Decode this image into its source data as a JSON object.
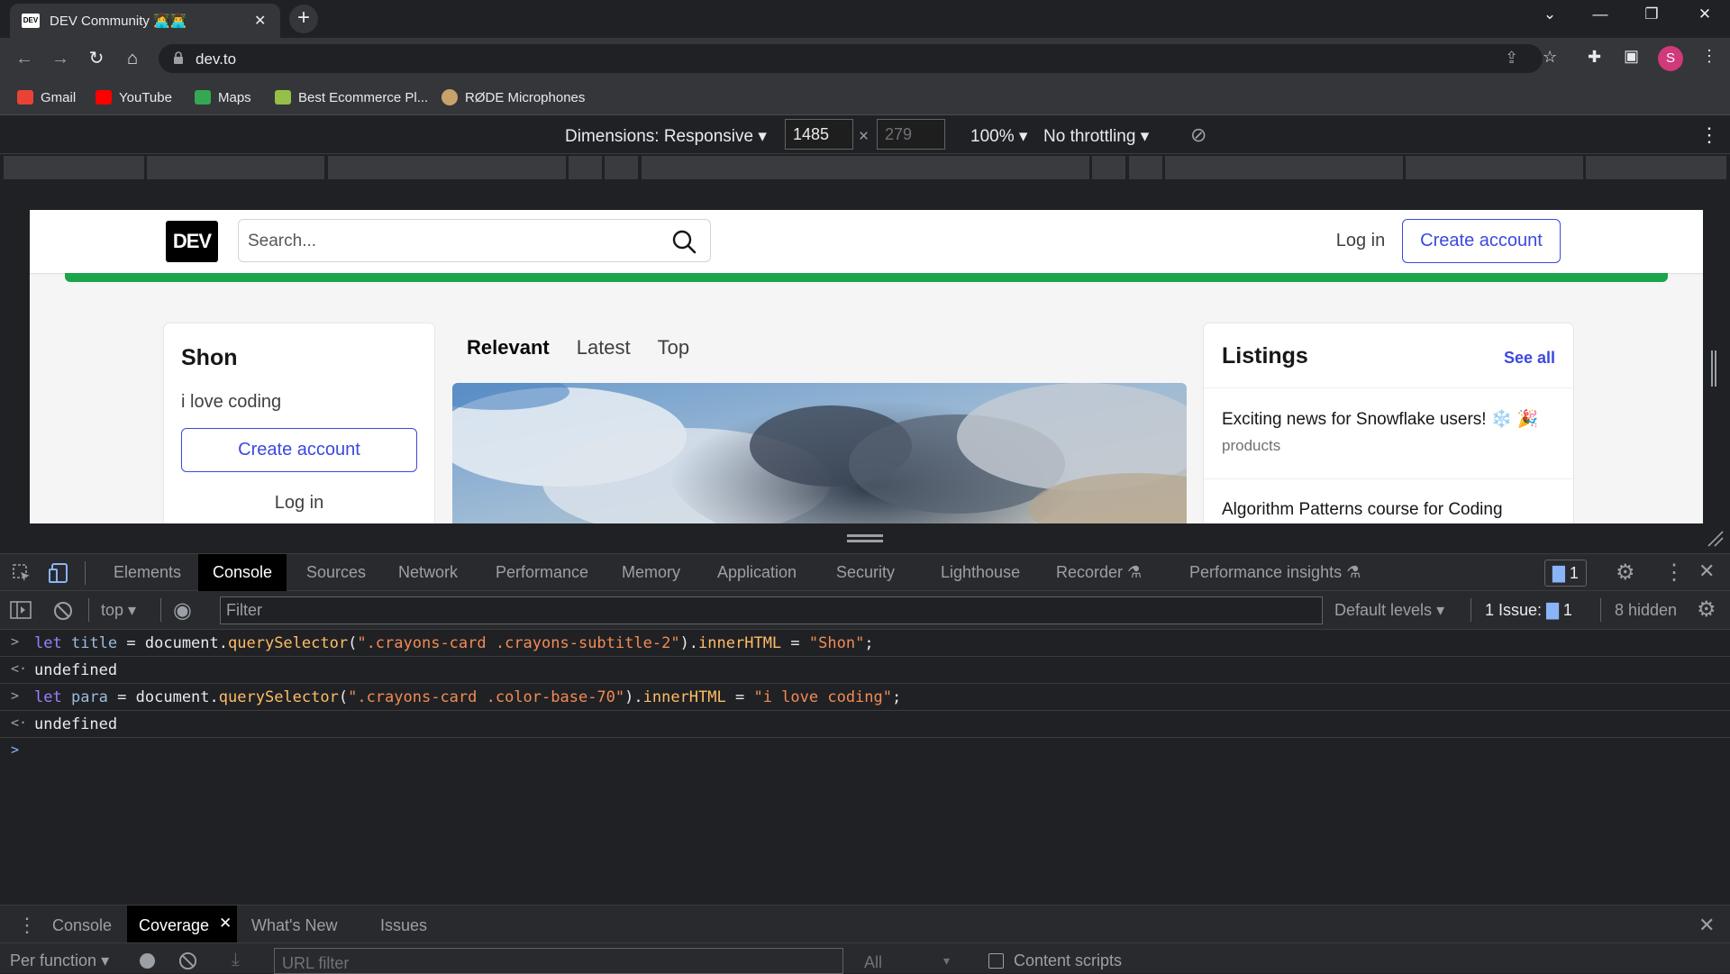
{
  "browser": {
    "tab_title": "DEV Community 👩‍💻👨‍💻",
    "favicon_text": "DEV",
    "url": "dev.to",
    "avatar_letter": "S",
    "bookmarks": [
      {
        "label": "Gmail",
        "color": "#ea4335"
      },
      {
        "label": "YouTube",
        "color": "#ff0000"
      },
      {
        "label": "Maps",
        "color": "#34a853"
      },
      {
        "label": "Best Ecommerce Pl...",
        "color": "#95bf47"
      },
      {
        "label": "RØDE Microphones",
        "color": "#c8a26b"
      }
    ]
  },
  "device_toolbar": {
    "dimensions_label": "Dimensions: Responsive",
    "width": "1485",
    "height": "279",
    "times": "×",
    "zoom": "100%",
    "throttling": "No throttling"
  },
  "site": {
    "logo": "DEV",
    "search_placeholder": "Search...",
    "login": "Log in",
    "create_account": "Create account",
    "profile": {
      "name": "Shon",
      "bio": "i love coding",
      "create_account": "Create account",
      "login": "Log in"
    },
    "feed_tabs": [
      "Relevant",
      "Latest",
      "Top"
    ],
    "listings": {
      "title": "Listings",
      "see_all": "See all",
      "items": [
        {
          "title": "Exciting news for Snowflake users! ❄️ 🎉",
          "category": "products"
        },
        {
          "title": "Algorithm Patterns course for Coding",
          "category": ""
        }
      ]
    }
  },
  "devtools": {
    "tabs": [
      "Elements",
      "Console",
      "Sources",
      "Network",
      "Performance",
      "Memory",
      "Application",
      "Security",
      "Lighthouse",
      "Recorder",
      "Performance insights"
    ],
    "active_tab": "Console",
    "issues_badge": "1",
    "console_bar": {
      "context": "top",
      "filter_placeholder": "Filter",
      "levels": "Default levels",
      "issues_label": "1 Issue:",
      "issues_count": "1",
      "hidden": "8 hidden"
    },
    "console": {
      "line1": {
        "kw": "let",
        "var": "title",
        "eq": " = ",
        "obj": "document",
        "dot": ".",
        "method": "querySelector",
        "open": "(",
        "arg": "\".crayons-card .crayons-subtitle-2\"",
        "close": ").",
        "prop": "innerHTML",
        "eq2": " = ",
        "val": "\"Shon\"",
        "end": ";"
      },
      "out1": "undefined",
      "line2": {
        "kw": "let",
        "var": "para",
        "eq": " = ",
        "obj": "document",
        "dot": ".",
        "method": "querySelector",
        "open": "(",
        "arg": "\".crayons-card .color-base-70\"",
        "close": ").",
        "prop": "innerHTML",
        "eq2": " = ",
        "val": "\"i love coding\"",
        "end": ";"
      },
      "out2": "undefined"
    },
    "drawer": {
      "tabs": [
        "Console",
        "Coverage",
        "What's New",
        "Issues"
      ],
      "active": "Coverage",
      "per_function": "Per function",
      "url_filter_placeholder": "URL filter",
      "all": "All",
      "content_scripts": "Content scripts"
    }
  }
}
